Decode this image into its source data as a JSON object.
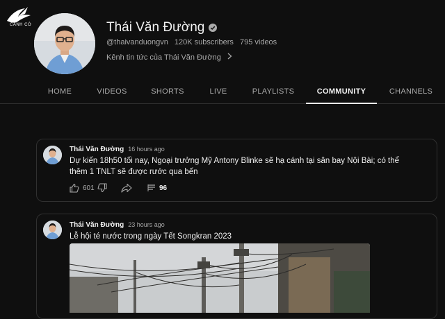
{
  "watermark": {
    "text": "CÁNH CÒ"
  },
  "channel": {
    "name": "Thái Văn Đường",
    "handle": "@thaivanduongvn",
    "subscribers": "120K subscribers",
    "videos": "795 videos",
    "description": "Kênh tin tức của Thái Văn Đường"
  },
  "tabs": [
    {
      "label": "HOME"
    },
    {
      "label": "VIDEOS"
    },
    {
      "label": "SHORTS"
    },
    {
      "label": "LIVE"
    },
    {
      "label": "PLAYLISTS"
    },
    {
      "label": "COMMUNITY"
    },
    {
      "label": "CHANNELS"
    }
  ],
  "active_tab": "COMMUNITY",
  "posts": [
    {
      "author": "Thái Văn Đường",
      "time": "16 hours ago",
      "text": "Dự kiến 18h50 tối nay, Ngoại trưởng Mỹ Antony Blinke sẽ hạ cánh tại sân bay Nội Bài; có thể thêm 1 TNLT sẽ được rước qua bến",
      "likes": "601",
      "comments": "96"
    },
    {
      "author": "Thái Văn Đường",
      "time": "23 hours ago",
      "text": "Lễ hội té nước trong ngày Tết Songkran 2023"
    }
  ],
  "colors": {
    "background": "#0f0f0f",
    "text": "#f1f1f1",
    "secondary": "#aaaaaa",
    "border": "#303030"
  }
}
